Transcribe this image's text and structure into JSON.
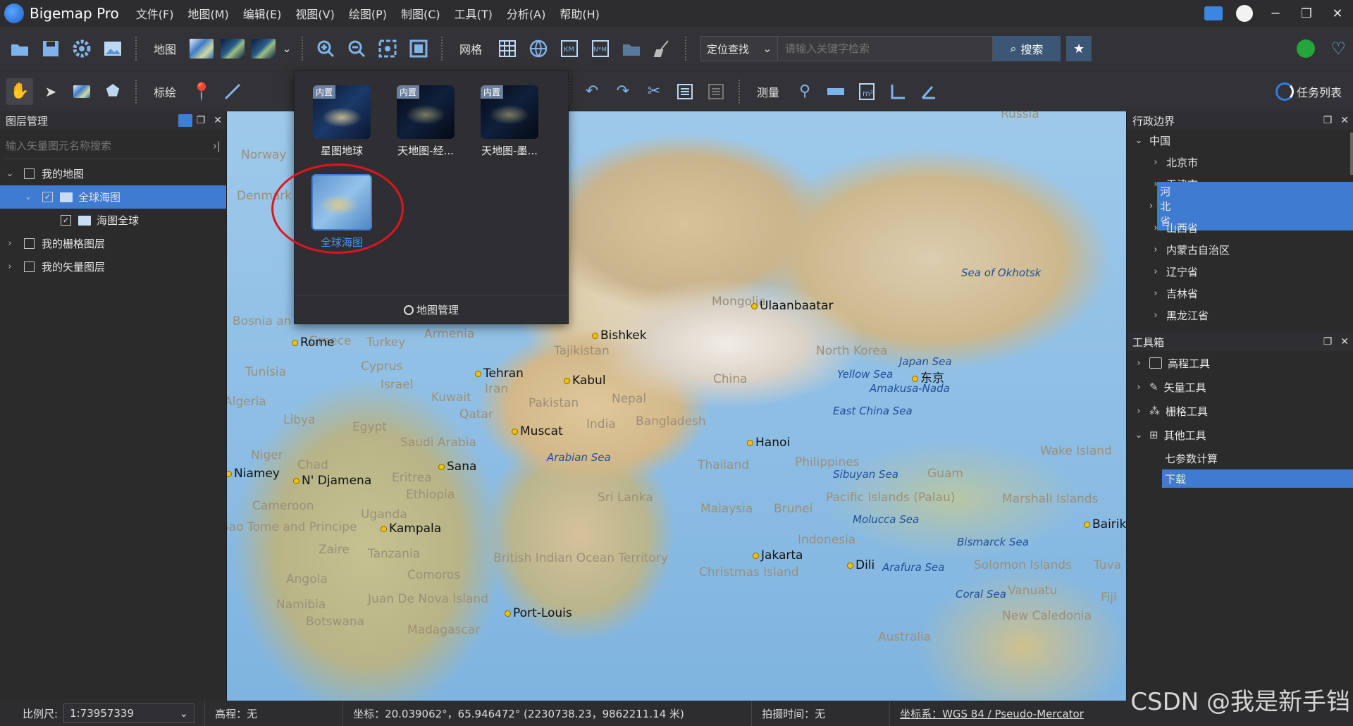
{
  "app": {
    "name": "Bigemap Pro"
  },
  "menu": [
    "文件(F)",
    "地图(M)",
    "编辑(E)",
    "视图(V)",
    "绘图(P)",
    "制图(C)",
    "工具(T)",
    "分析(A)",
    "帮助(H)"
  ],
  "toolbar1": {
    "map_label": "地图",
    "grid_label": "网格",
    "locate_select": "定位查找",
    "search_placeholder": "请输入关键字检索",
    "search_button": "搜索"
  },
  "toolbar2": {
    "draw_label": "标绘",
    "measure_label": "测量",
    "task_list": "任务列表"
  },
  "layer_panel": {
    "title": "图层管理",
    "search_placeholder": "输入矢量图元名称搜索",
    "tree": [
      {
        "label": "我的地图",
        "level": 0,
        "expanded": true,
        "checked": false
      },
      {
        "label": "全球海图",
        "level": 1,
        "expanded": true,
        "checked": true,
        "selected": true
      },
      {
        "label": "海图全球",
        "level": 2,
        "checked": true
      },
      {
        "label": "我的栅格图层",
        "level": 0,
        "expanded": false,
        "checked": false
      },
      {
        "label": "我的矢量图层",
        "level": 0,
        "expanded": false,
        "checked": false
      }
    ]
  },
  "basemap_popup": {
    "items": [
      {
        "tag": "内置",
        "label": "星图地球",
        "style": "dark"
      },
      {
        "tag": "内置",
        "label": "天地图-经...",
        "style": "night"
      },
      {
        "tag": "内置",
        "label": "天地图-墨...",
        "style": "night"
      },
      {
        "tag": "",
        "label": "全球海图",
        "style": "light",
        "selected": true
      }
    ],
    "footer": "地图管理"
  },
  "admin_panel": {
    "title": "行政边界",
    "root": "中国",
    "items": [
      "北京市",
      "天津市",
      "河北省",
      "山西省",
      "内蒙古自治区",
      "辽宁省",
      "吉林省",
      "黑龙江省"
    ],
    "selected": "河北省"
  },
  "toolbox_panel": {
    "title": "工具箱",
    "groups": [
      "高程工具",
      "矢量工具",
      "栅格工具",
      "其他工具"
    ],
    "other_children": [
      "七参数计算",
      "下载"
    ],
    "selected": "下载"
  },
  "map": {
    "places": [
      "Russia",
      "Norway",
      "Denmark",
      "Mongolia",
      "China",
      "Armenia",
      "Turkey",
      "Greece",
      "Tunisia",
      "Algeria",
      "Libya",
      "Egypt",
      "Israel",
      "Cyprus",
      "Kuwait",
      "Iran",
      "Pakistan",
      "Nepal",
      "India",
      "Bangladesh",
      "Qatar",
      "Saudi Arabia",
      "Eritrea",
      "Ethiopia",
      "Niger",
      "Chad",
      "Cameroon",
      "Uganda",
      "Zaire",
      "Tanzania",
      "Angola",
      "Namibia",
      "Botswana",
      "Madagascar",
      "Comoros",
      "Juan De Nova Island",
      "Sri Lanka",
      "Thailand",
      "Malaysia",
      "Brunei",
      "Philippines",
      "Indonesia",
      "North Korea",
      "Wake Island",
      "Guam",
      "Marshall Islands",
      "Pacific Islands (Palau)",
      "Solomon Islands",
      "Vanuatu",
      "New Caledonia",
      "Australia",
      "Christmas Island",
      "British Indian Ocean Territory",
      "Tajikistan",
      "Bosnia an",
      "Sao Tome and Principe",
      "Fiji",
      "Tuva"
    ],
    "cities": [
      "Ulaanbaatar",
      "Bishkek",
      "Tehran",
      "Kabul",
      "Muscat",
      "Sana",
      "N' Djamena",
      "Niamey",
      "Kampala",
      "Port-Louis",
      "Hanoi",
      "Jakarta",
      "Dili",
      "东京",
      "Rome",
      "Bairik"
    ],
    "seas": [
      "Sea of Okhotsk",
      "Japan Sea",
      "Yellow Sea",
      "Amakusa-Nada",
      "East China Sea",
      "Arabian Sea",
      "Sibuyan Sea",
      "Molucca Sea",
      "Bismarck Sea",
      "Arafura Sea",
      "Coral Sea"
    ]
  },
  "status": {
    "scale_label": "比例尺:",
    "scale_value": "1:73957339",
    "elevation": "高程：无",
    "coords": "坐标：20.039062°，65.946472°   (2230738.23，9862211.14 米)",
    "capture_time": "拍摄时间：无",
    "crs": "坐标系：WGS 84 / Pseudo-Mercator"
  },
  "watermark": "CSDN @我是新手铛"
}
